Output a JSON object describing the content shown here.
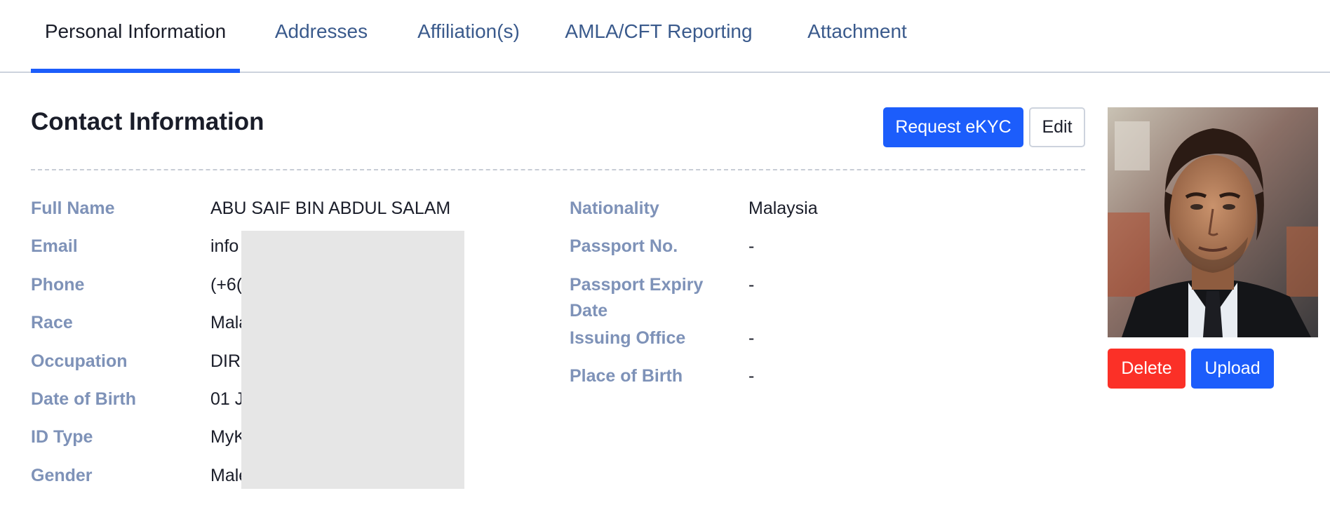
{
  "tabs": [
    {
      "label": "Personal Information",
      "active": true
    },
    {
      "label": "Addresses"
    },
    {
      "label": "Affiliation(s)"
    },
    {
      "label": "AMLA/CFT Reporting"
    },
    {
      "label": "Attachment"
    }
  ],
  "section": {
    "title": "Contact Information",
    "request_ekyc_label": "Request eKYC",
    "edit_label": "Edit"
  },
  "left_fields": [
    {
      "label": "Full Name",
      "value": "ABU SAIF BIN ABDUL SALAM"
    },
    {
      "label": "Email",
      "value": "info"
    },
    {
      "label": "Phone",
      "value": "(+6("
    },
    {
      "label": "Race",
      "value": "Mala"
    },
    {
      "label": "Occupation",
      "value": "DIRE"
    },
    {
      "label": "Date of Birth",
      "value": "01 J"
    },
    {
      "label": "ID Type",
      "value": "MyK"
    },
    {
      "label": "Gender",
      "value": "Male"
    }
  ],
  "right_fields": [
    {
      "label": "Nationality",
      "value": "Malaysia"
    },
    {
      "label": "Passport No.",
      "value": "-"
    },
    {
      "label": "Passport Expiry",
      "label_line2": "Date",
      "value": "-"
    },
    {
      "label": "Issuing Office",
      "value": "-"
    },
    {
      "label": "Place of Birth",
      "value": "-"
    }
  ],
  "photo": {
    "delete_label": "Delete",
    "upload_label": "Upload"
  },
  "colors": {
    "accent": "#1c5dfb",
    "danger": "#fb3027",
    "label": "#7e92b8",
    "tab_inactive": "#3a5a8c"
  }
}
